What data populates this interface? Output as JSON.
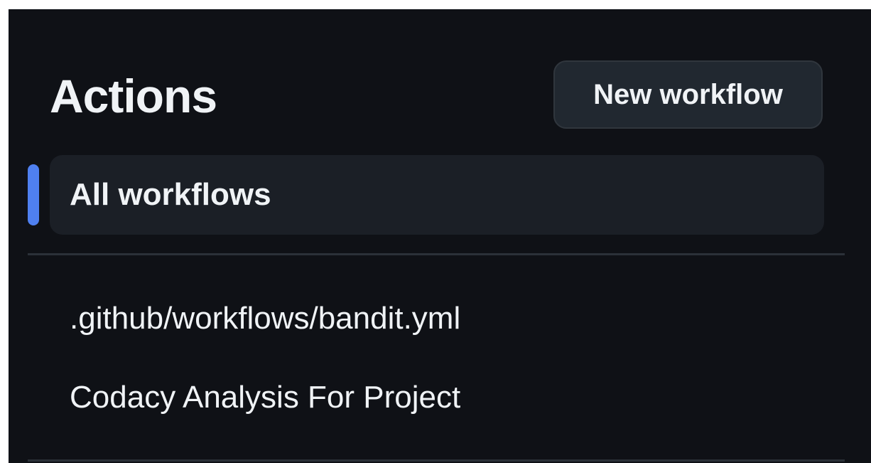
{
  "header": {
    "title": "Actions",
    "new_workflow_label": "New workflow"
  },
  "nav": {
    "all_workflows_label": "All workflows",
    "workflows": [
      {
        "label": ".github/workflows/bandit.yml"
      },
      {
        "label": "Codacy Analysis For Project"
      }
    ]
  },
  "colors": {
    "background": "#0f1116",
    "text": "#f0f3f6",
    "button_bg": "#212830",
    "border": "#30363d",
    "selected_bg": "#1b1f26",
    "accent": "#4f80f0",
    "divider": "#2b3138"
  }
}
